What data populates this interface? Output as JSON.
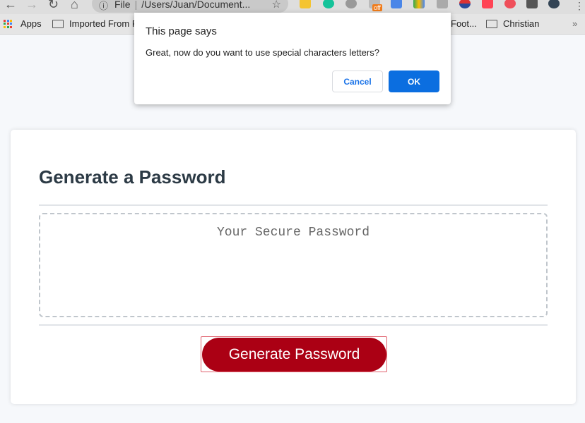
{
  "browser": {
    "address_scheme": "File",
    "address_text": "/Users/Juan/Document...",
    "bookmarks": [
      {
        "label": "Apps",
        "icon": "apps-grid-icon"
      },
      {
        "label": "Imported From F",
        "icon": "folder-icon"
      },
      {
        "label": "Foot...",
        "icon": "folder-icon"
      },
      {
        "label": "Christian",
        "icon": "folder-icon"
      }
    ],
    "more_bookmarks": "»",
    "extension_badge": "off"
  },
  "dialog": {
    "title": "This page says",
    "message": "Great, now do you want to use special characters letters?",
    "cancel_label": "Cancel",
    "ok_label": "OK"
  },
  "card": {
    "title": "Generate a Password",
    "password_placeholder": "Your Secure Password",
    "generate_label": "Generate Password"
  },
  "colors": {
    "accent_blue": "#0b6ee0",
    "button_red": "#ab0014",
    "title_color": "#2c3a45"
  }
}
